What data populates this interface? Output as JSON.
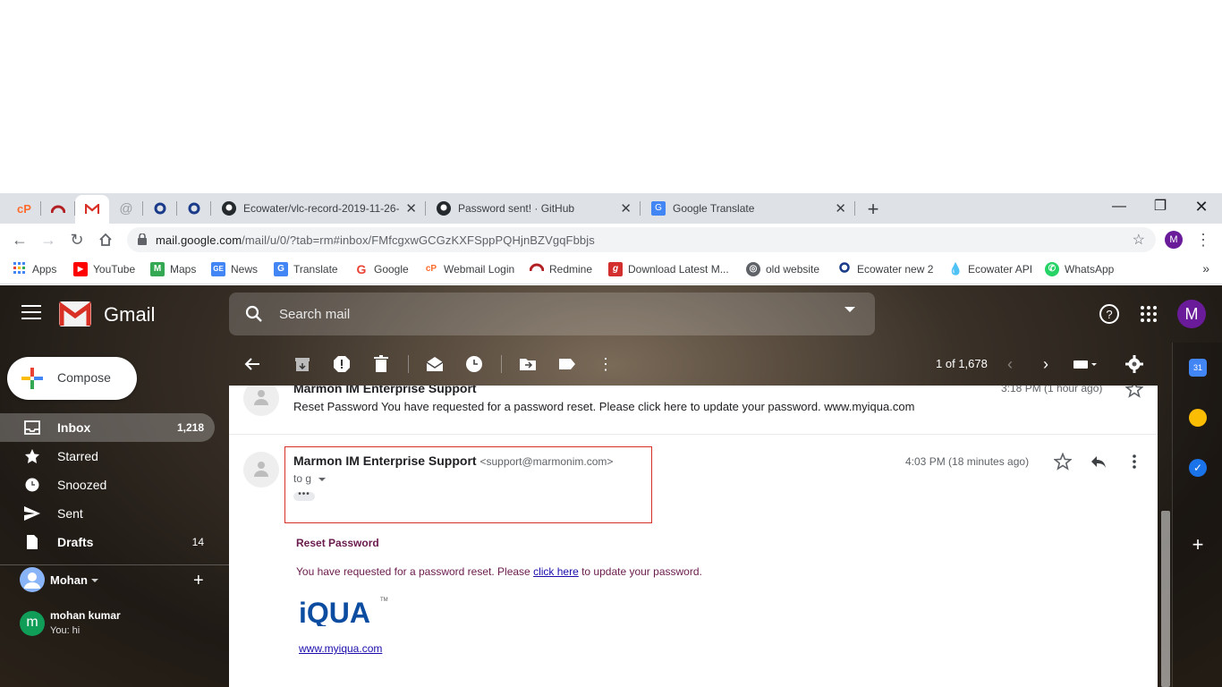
{
  "browser": {
    "tabs": [
      {
        "title": "",
        "icon": "cpanel-icon"
      },
      {
        "title": "",
        "icon": "redmine-icon"
      },
      {
        "title": "",
        "icon": "gmail-icon"
      },
      {
        "title": "",
        "icon": "at-icon"
      },
      {
        "title": "",
        "icon": "iqua-icon"
      },
      {
        "title": "",
        "icon": "iqua-icon"
      },
      {
        "title": "Ecowater/vlc-record-2019-11-26-",
        "icon": "github-icon"
      },
      {
        "title": "Password sent! · GitHub",
        "icon": "github-icon"
      },
      {
        "title": "Google Translate",
        "icon": "translate-icon"
      }
    ],
    "url_host": "mail.google.com",
    "url_path": "/mail/u/0/?tab=rm#inbox/FMfcgxwGCGzKXFSppPQHjnBZVgqFbbjs",
    "profile_initial": "M",
    "bookmarks": [
      {
        "label": "Apps",
        "icon": "apps-grid-icon",
        "color": "#4285f4"
      },
      {
        "label": "YouTube",
        "icon": "youtube-icon",
        "color": "#ff0000"
      },
      {
        "label": "Maps",
        "icon": "maps-icon",
        "color": "#34a853"
      },
      {
        "label": "News",
        "icon": "news-icon",
        "color": "#4285f4"
      },
      {
        "label": "Translate",
        "icon": "translate-icon",
        "color": "#4285f4"
      },
      {
        "label": "Google",
        "icon": "google-icon",
        "color": "#ea4335"
      },
      {
        "label": "Webmail Login",
        "icon": "cpanel-icon",
        "color": "#ff6c2c"
      },
      {
        "label": "Redmine",
        "icon": "redmine-icon",
        "color": "#b32024"
      },
      {
        "label": "Download Latest M...",
        "icon": "g-icon",
        "color": "#d32f2f"
      },
      {
        "label": "old website",
        "icon": "globe-icon",
        "color": "#5f6368"
      },
      {
        "label": "Ecowater new 2",
        "icon": "iqua-icon",
        "color": "#1a3a8a"
      },
      {
        "label": "Ecowater API",
        "icon": "drop-icon",
        "color": "#00a3a3"
      },
      {
        "label": "WhatsApp",
        "icon": "whatsapp-icon",
        "color": "#25d366"
      }
    ],
    "more_bookmarks": "»"
  },
  "gmail": {
    "logo_text": "Gmail",
    "search_placeholder": "Search mail",
    "avatar_initial": "M",
    "compose_label": "Compose",
    "nav": [
      {
        "label": "Inbox",
        "count": "1,218",
        "icon": "inbox-icon",
        "active": true
      },
      {
        "label": "Starred",
        "count": "",
        "icon": "star-icon"
      },
      {
        "label": "Snoozed",
        "count": "",
        "icon": "clock-icon"
      },
      {
        "label": "Sent",
        "count": "",
        "icon": "send-icon"
      },
      {
        "label": "Drafts",
        "count": "14",
        "icon": "draft-icon"
      }
    ],
    "hangouts_user": "Mohan",
    "contact": {
      "initial": "m",
      "name": "mohan kumar",
      "last_msg": "You: hi"
    },
    "paging": "1 of 1,678"
  },
  "thread": {
    "prev_message": {
      "sender": "Marmon IM Enterprise Support",
      "snippet": "Reset Password You have requested for a password reset. Please click here to update your password. www.myiqua.com",
      "time": "3:18 PM (1 hour ago)"
    },
    "message": {
      "sender": "Marmon IM Enterprise Support",
      "email": "<support@marmonim.com>",
      "to": "to g",
      "time": "4:03 PM (18 minutes ago)",
      "body_title": "Reset Password",
      "body_pre": "You have requested for a password reset. Please ",
      "body_link": "click here",
      "body_post": " to update your password.",
      "logo_text": "iQUA",
      "logo_tm": "TM",
      "footer_link": "www.myiqua.com"
    }
  },
  "colors": {
    "accent_purple": "#6a1b9a",
    "highlight_red": "#d93025",
    "link_blue": "#1a0dab"
  }
}
